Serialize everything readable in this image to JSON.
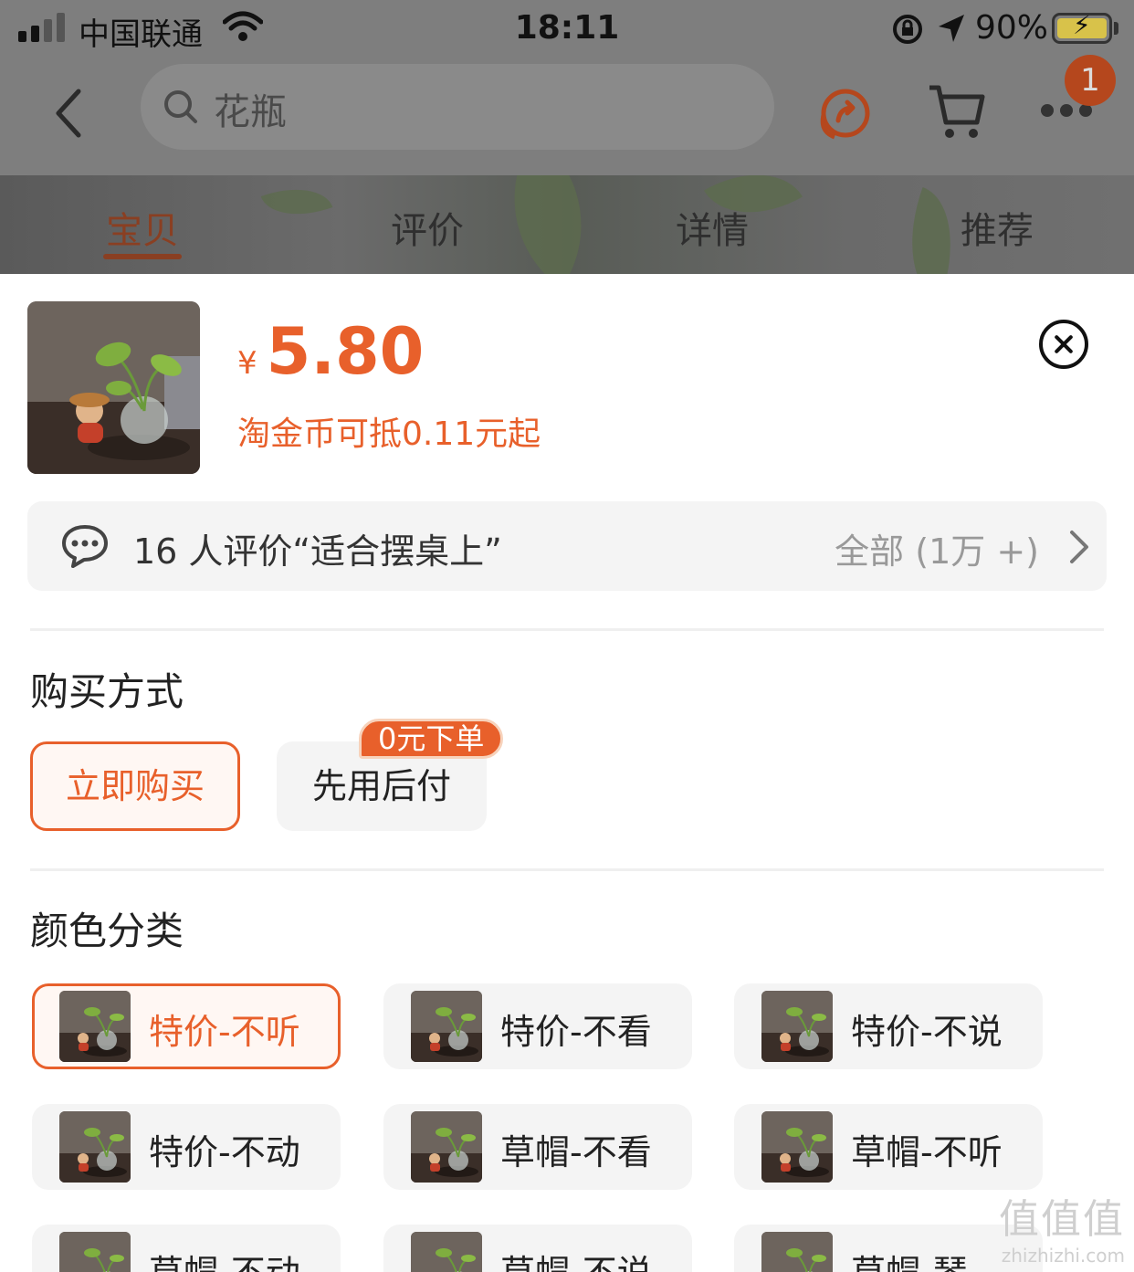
{
  "status_bar": {
    "carrier": "中国联通",
    "time": "18:11",
    "battery": "90%"
  },
  "nav": {
    "search_text": "花瓶",
    "cart_badge": "1"
  },
  "tabs": [
    {
      "label": "宝贝",
      "active": true
    },
    {
      "label": "评价",
      "active": false
    },
    {
      "label": "详情",
      "active": false
    },
    {
      "label": "推荐",
      "active": false
    }
  ],
  "product": {
    "currency": "¥",
    "price": "5.80",
    "coin_tip": "淘金币可抵0.11元起"
  },
  "review": {
    "summary": "16 人评价“适合摆桌上”",
    "all": "全部 (1万 +)"
  },
  "purchase": {
    "title": "购买方式",
    "options": [
      {
        "label": "立即购买",
        "selected": true
      },
      {
        "label": "先用后付",
        "selected": false
      }
    ],
    "promo_tag": "0元下单"
  },
  "color": {
    "title": "颜色分类",
    "options": [
      {
        "label": "特价-不听",
        "selected": true
      },
      {
        "label": "特价-不看",
        "selected": false
      },
      {
        "label": "特价-不说",
        "selected": false
      },
      {
        "label": "特价-不动",
        "selected": false
      },
      {
        "label": "草帽-不看",
        "selected": false
      },
      {
        "label": "草帽-不听",
        "selected": false
      },
      {
        "label": "草帽-不动",
        "selected": false
      },
      {
        "label": "草帽-不说",
        "selected": false
      },
      {
        "label": "草帽-琴",
        "selected": false
      }
    ]
  },
  "watermark": {
    "big": "值值值",
    "small": "zhizhizhi.com"
  },
  "colors": {
    "accent": "#e8602b",
    "overlay": "#7e7e7e",
    "chip_bg": "#f4f4f4"
  }
}
